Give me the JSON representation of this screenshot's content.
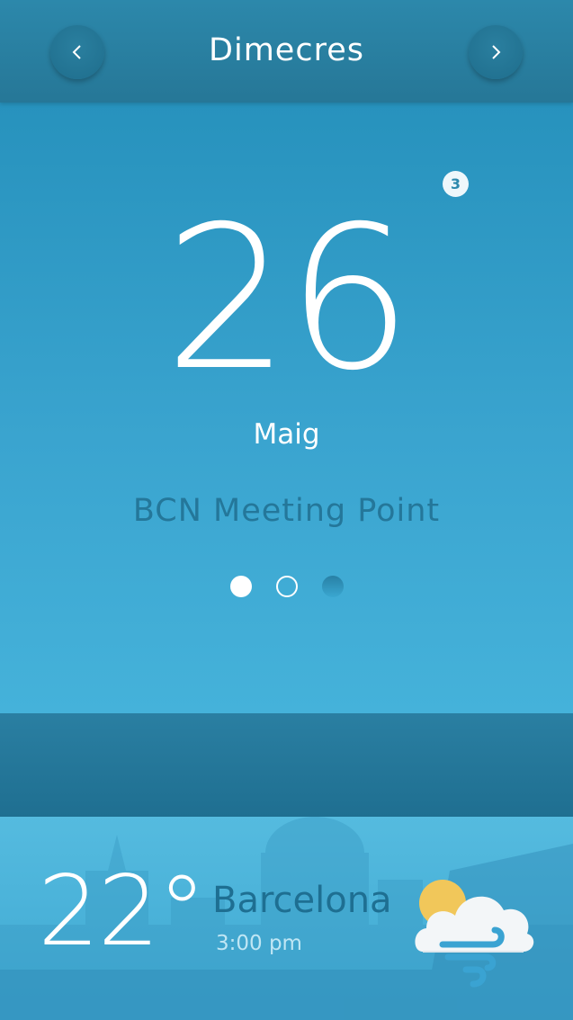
{
  "header": {
    "title": "Dimecres",
    "prev_icon": "chevron-left-icon",
    "next_icon": "chevron-right-icon"
  },
  "card": {
    "badge": "3",
    "day": "26",
    "month": "Maig",
    "event": "BCN Meeting Point",
    "pagination": {
      "total": 3,
      "active": 1
    }
  },
  "weather": {
    "temperature": "22°",
    "city": "Barcelona",
    "time": "3:00 pm",
    "icon": "sun-cloud-wind-icon"
  },
  "colors": {
    "header": "#2a84a7",
    "card_top": "#2792bd",
    "card_bottom": "#45b2da",
    "band": "#2378a0",
    "event_text": "#24779a",
    "sun": "#f1c75a"
  }
}
